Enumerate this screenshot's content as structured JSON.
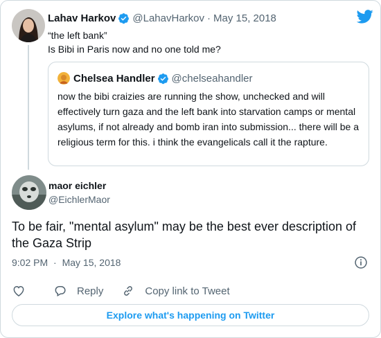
{
  "colors": {
    "accent": "#1d9bf0",
    "muted": "#536471",
    "border": "#cfd9de",
    "text": "#0f1419"
  },
  "parent_tweet": {
    "author_name": "Lahav Harkov",
    "handle": "@LahavHarkov",
    "separator": "·",
    "date": "May 15, 2018",
    "text": "“the left bank”\nIs Bibi in Paris now and no one told me?",
    "avatar_icon": "person-photo"
  },
  "quoted_tweet": {
    "author_name": "Chelsea Handler",
    "handle": "@chelseahandler",
    "text": "now the bibi craizies are running the show, unchecked and will effectively turn gaza and the left bank into starvation camps or mental asylums, if not already and bomb iran into submission... there will be a religious term for this. i think the evangelicals call it the rapture.",
    "avatar_icon": "person-photo-small"
  },
  "reply_tweet": {
    "author_name": "maor eichler",
    "handle": "@EichlerMaor",
    "text": "To be fair, \"mental asylum\" may be the best ever description of the Gaza Strip",
    "avatar_icon": "dog-photo"
  },
  "meta": {
    "time": "9:02 PM",
    "separator": "·",
    "date": "May 15, 2018"
  },
  "actions": {
    "like_icon": "heart-icon",
    "reply_label": "Reply",
    "copy_link_label": "Copy link to Tweet"
  },
  "explore_label": "Explore what's happening on Twitter"
}
